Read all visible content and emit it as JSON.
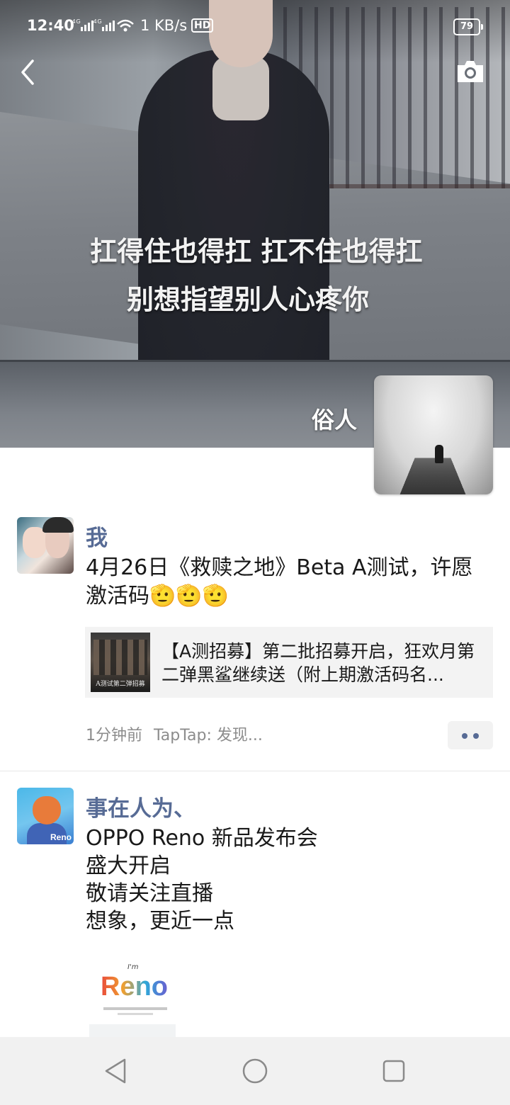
{
  "status_bar": {
    "time": "12:40",
    "signal": "4G 4G",
    "speed": "1 KB/s",
    "hd": "HD",
    "battery": "79"
  },
  "cover": {
    "caption_line1": "扛得住也得扛 扛不住也得扛",
    "caption_line2": "别想指望别人心疼你",
    "profile_name": "俗人"
  },
  "icons": {
    "back": "chevron-left-icon",
    "camera": "camera-icon"
  },
  "posts": [
    {
      "name": "我",
      "text": "4月26日《救赎之地》Beta A测试，许愿激活码",
      "emoji_count": 3,
      "link_card": {
        "thumb_caption": "A测试第二弹招募",
        "title": "【A测招募】第二批招募开启，狂欢月第二弹黑鲨继续送（附上期激活码名..."
      },
      "time": "1分钟前",
      "source": "TapTap: 发现..."
    },
    {
      "name": "事在人为、",
      "text": "OPPO Reno 新品发布会\n盛大开启\n敬请关注直播\n想象，更近一点",
      "image": {
        "im_text": "I'm",
        "logo_text": "Reno",
        "avatar_badge": "Reno"
      }
    }
  ],
  "colors": {
    "name_color": "#576b95",
    "text_color": "#191919",
    "meta_color": "#8c8c8c",
    "nav_bg": "#f1f1f1"
  }
}
